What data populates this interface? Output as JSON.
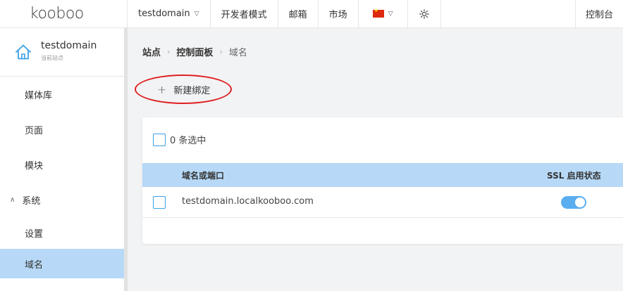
{
  "header": {
    "logo": "kooboo",
    "site_selector": "testdomain",
    "dev_mode": "开发者模式",
    "mailbox": "邮箱",
    "market": "市场",
    "control_panel": "控制台"
  },
  "sidebar": {
    "site_name": "testdomain",
    "site_sub": "当前站点",
    "items": [
      {
        "label": "媒体库"
      },
      {
        "label": "页面"
      },
      {
        "label": "模块"
      },
      {
        "label": "系统"
      },
      {
        "label": "设置"
      },
      {
        "label": "域名"
      }
    ]
  },
  "breadcrumb": {
    "site": "站点",
    "panel": "控制面板",
    "current": "域名"
  },
  "toolbar": {
    "new_binding_label": "新建绑定"
  },
  "table": {
    "selection_text": "0 条选中",
    "columns": [
      "域名或端口",
      "SSL 启用状态"
    ],
    "rows": [
      {
        "domain": "testdomain.localkooboo.com",
        "ssl_enabled": true
      }
    ]
  },
  "colors": {
    "accent": "#5aaef0",
    "active_bg": "#b7d9f7",
    "annotation": "#e02020"
  }
}
